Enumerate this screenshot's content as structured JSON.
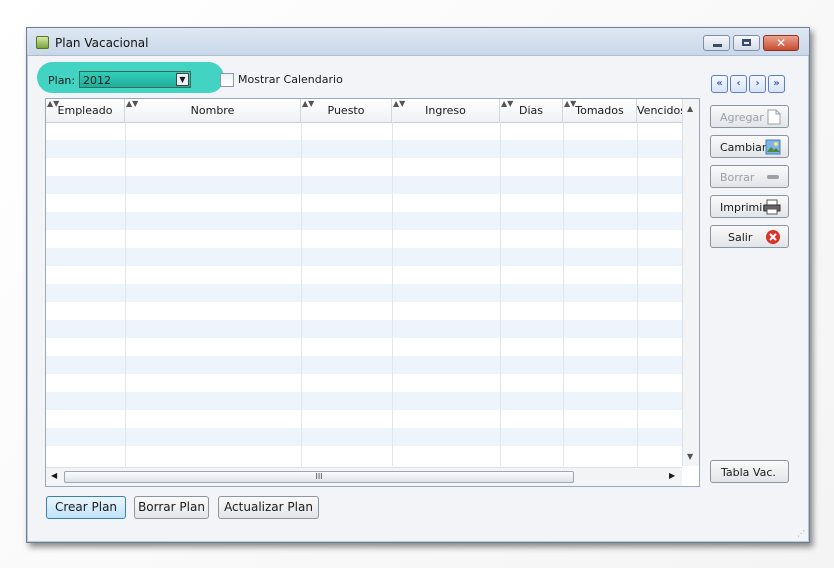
{
  "window": {
    "title": "Plan Vacacional"
  },
  "plan": {
    "label": "Plan:",
    "value": "2012"
  },
  "calendar": {
    "label": "Mostrar Calendario",
    "checked": false
  },
  "grid": {
    "columns": [
      "Empleado",
      "Nombre",
      "Puesto",
      "Ingreso",
      "Dias",
      "Tomados",
      "Vencidos"
    ],
    "scroll_thumb": "III"
  },
  "actions": {
    "agregar": "Agregar",
    "cambiar": "Cambiar",
    "borrar": "Borrar",
    "imprimir": "Imprimir",
    "salir": "Salir",
    "tabla_vac": "Tabla Vac."
  },
  "bottom": {
    "crear": "Crear Plan",
    "borrar_plan": "Borrar Plan",
    "actualizar": "Actualizar Plan"
  },
  "colors": {
    "highlight": "#38d1c0",
    "accent": "#3a5fb0",
    "close": "#c94a31"
  }
}
